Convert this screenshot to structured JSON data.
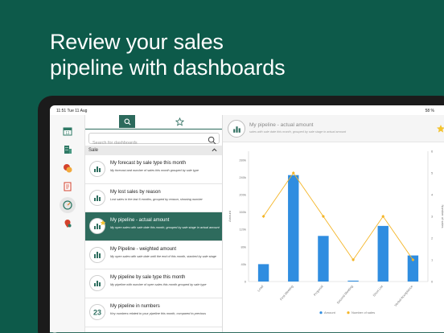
{
  "headline": {
    "line1": "Review your sales",
    "line2": "pipeline with dashboards"
  },
  "status": {
    "time": "11:51  Tue 11 Aug",
    "battery": "58 %"
  },
  "rail": {
    "items": [
      {
        "icon": "calendar-icon",
        "badge": "11"
      },
      {
        "icon": "building-icon"
      },
      {
        "icon": "coins-icon"
      },
      {
        "icon": "clipboard-icon"
      },
      {
        "icon": "dashboard-gauge-icon",
        "active": true
      },
      {
        "icon": "location-pin-icon"
      }
    ]
  },
  "search": {
    "placeholder": "Search for dashboards"
  },
  "section": {
    "label": "Sale"
  },
  "dashboards": [
    {
      "title": "My forecast by sale type this month",
      "desc": "My forecast and number of sales this month grouped by sale type",
      "icon": "bar-chart-icon"
    },
    {
      "title": "My lost sales by reason",
      "desc": "Lost sales in the last 6 months, grouped by reason, showing number",
      "icon": "bar-chart-icon"
    },
    {
      "title": "My pipeline - actual amount",
      "desc": "My open sales with sale date this month, grouped by sale stage in actual amount",
      "icon": "bar-chart-icon",
      "selected": true,
      "favorite": true
    },
    {
      "title": "My Pipeline - weighted amount",
      "desc": "My open sales with sale date until the end of this month, stacked by sale stage",
      "icon": "bar-chart-icon"
    },
    {
      "title": "My pipeline by sale type this month",
      "desc": "My pipeline with number of open sales this month grouped by sale type",
      "icon": "bar-chart-icon"
    },
    {
      "title": "My pipeline in numbers",
      "desc": "Key numbers related to your pipeline this month, compared to previous",
      "icon": "numbers-icon",
      "badge": "23"
    }
  ],
  "detail": {
    "title": "My pipeline - actual amount",
    "subtitle": "sales with sale date this month, grouped by sale stage in actual amount"
  },
  "chart_data": {
    "type": "bar",
    "categories": [
      "Lead",
      "First Meeting",
      "Proposal",
      "Second Meeting",
      "Short List",
      "Verbal Acceptance"
    ],
    "series": [
      {
        "name": "Amount",
        "kind": "bar",
        "axis": "left",
        "values": [
          40000,
          245000,
          105000,
          2000,
          128000,
          60000
        ],
        "color": "#2f8de0"
      },
      {
        "name": "Number of sales",
        "kind": "line",
        "axis": "right",
        "values": [
          3,
          5,
          3,
          1,
          3,
          1
        ],
        "color": "#f4b526"
      }
    ],
    "ylabel": "Amount",
    "y2label": "Number of sales",
    "ylim": [
      0,
      300000
    ],
    "y2lim": [
      0,
      6
    ],
    "yticks": [
      "0",
      "40k",
      "80k",
      "120k",
      "160k",
      "200k",
      "240k",
      "280k"
    ],
    "y2ticks": [
      "0",
      "1",
      "2",
      "3",
      "4",
      "5",
      "6"
    ],
    "legend_position": "bottom",
    "grid": false
  }
}
